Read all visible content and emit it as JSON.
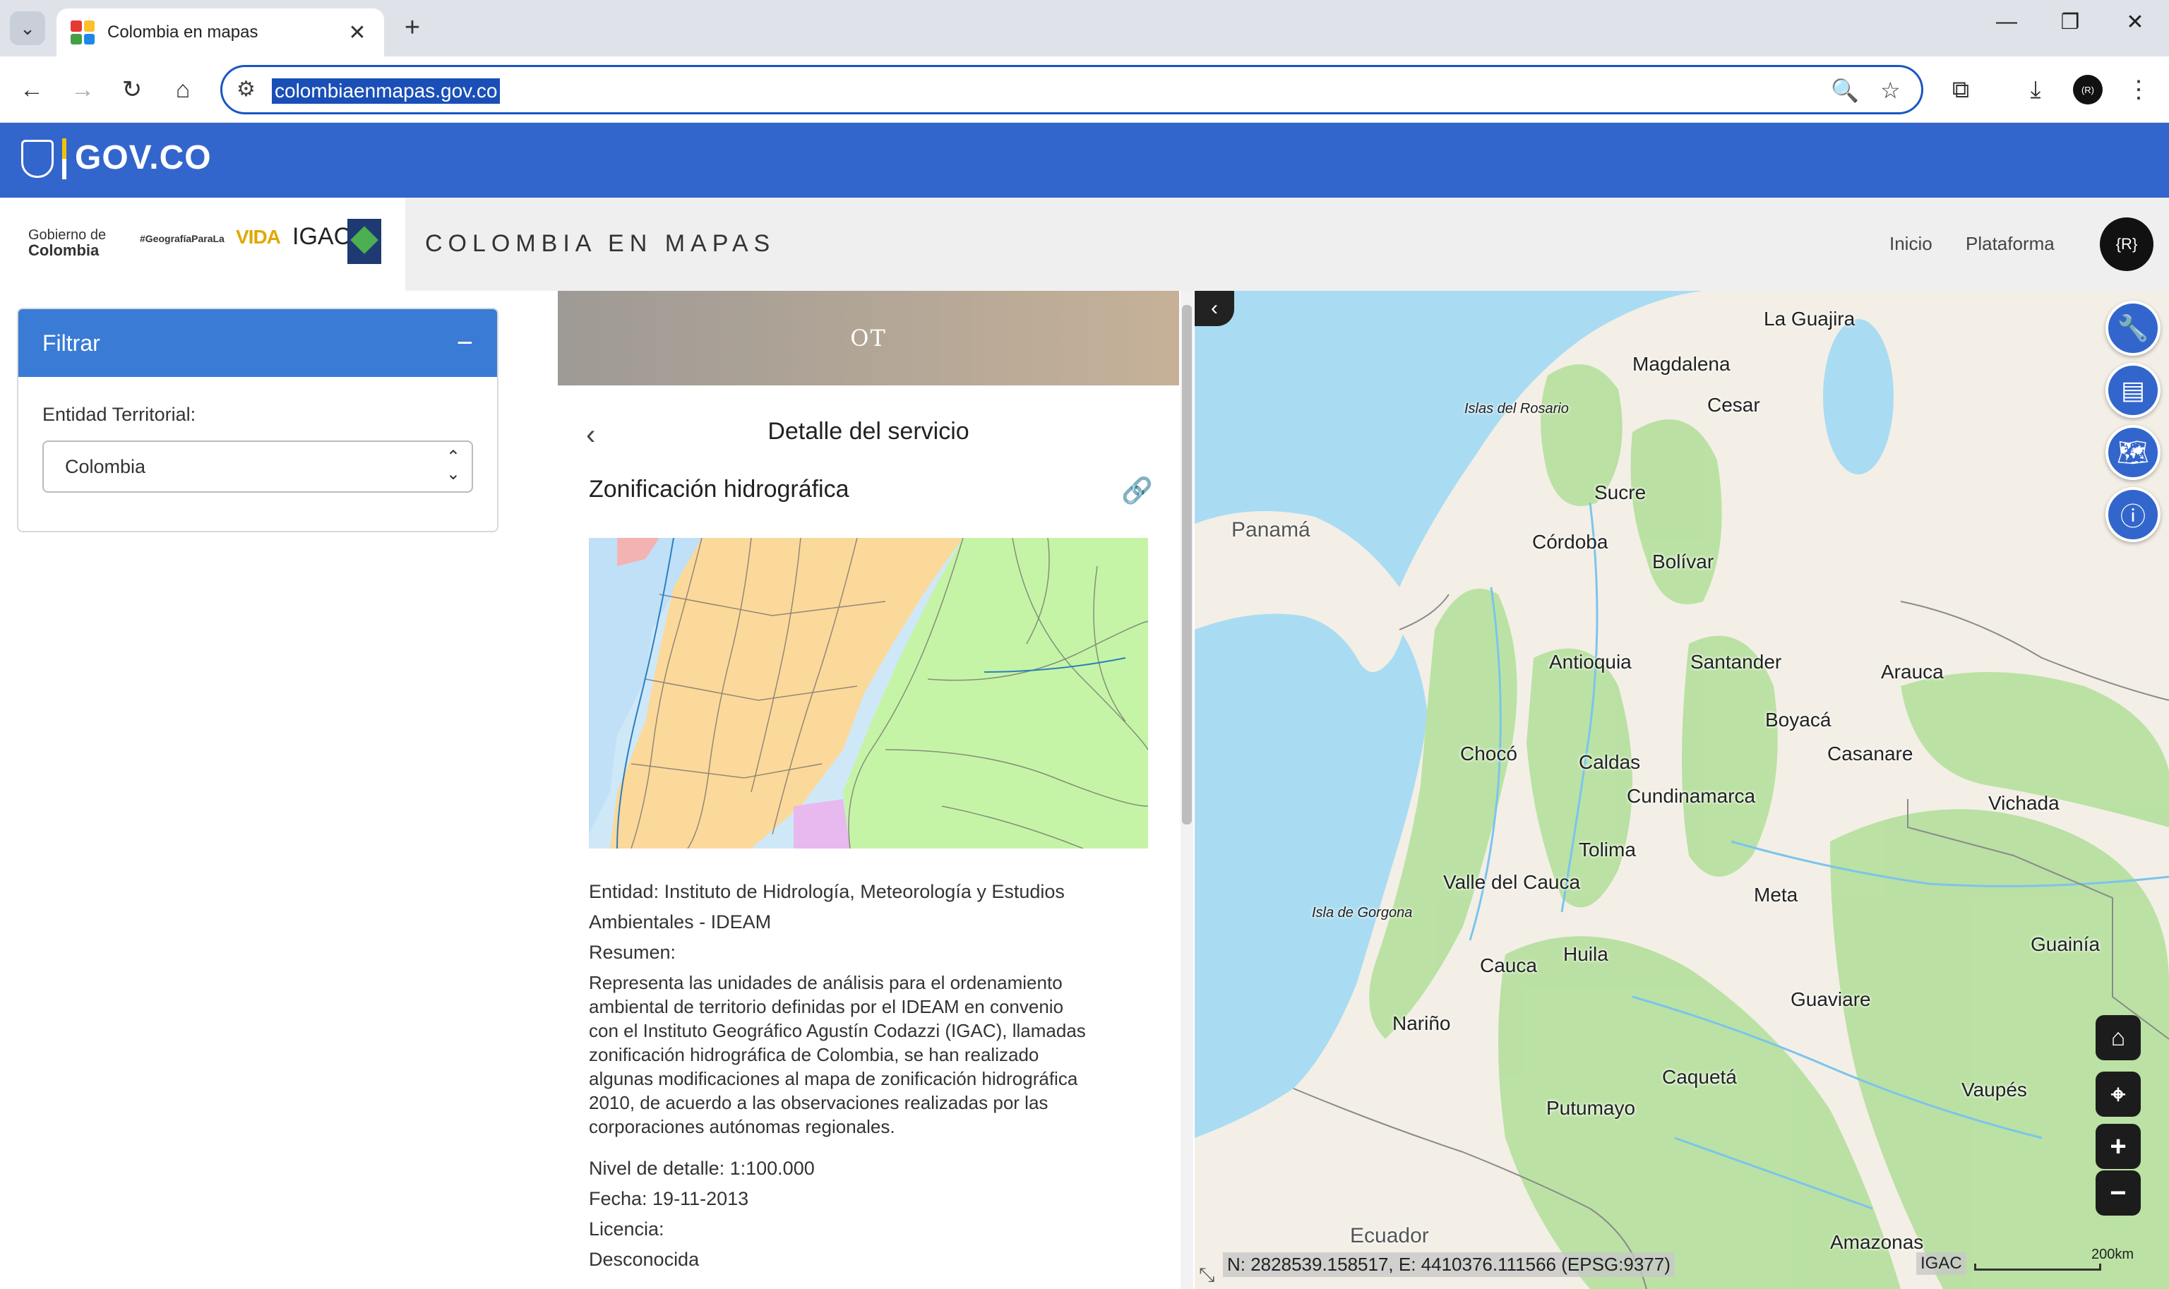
{
  "browser": {
    "tab_title": "Colombia en mapas",
    "url": "colombiaenmapas.gov.co",
    "new_tab_symbol": "+",
    "tab_close_symbol": "✕",
    "profile_initial": "(R)"
  },
  "gov_bar": {
    "brand": "GOV.CO"
  },
  "header": {
    "logo_gobierno_line1": "Gobierno de",
    "logo_gobierno_line2": "Colombia",
    "logo_hashtag": "#GeografíaParaLa",
    "logo_vida": "VIDA",
    "logo_igac": "IGAC",
    "site_title": "COLOMBIA EN MAPAS",
    "nav": [
      "Inicio",
      "Plataforma"
    ],
    "user_initial": "{R}"
  },
  "filter": {
    "title": "Filtrar",
    "collapse_symbol": "−",
    "entity_label": "Entidad Territorial:",
    "entity_value": "Colombia"
  },
  "detail": {
    "banner": "OT",
    "heading": "Detalle del servicio",
    "service_title": "Zonificación hidrográfica",
    "entity": "Entidad: Instituto de Hidrología, Meteorología y Estudios Ambientales - IDEAM",
    "entity_line1": "Entidad: Instituto de Hidrología, Meteorología y Estudios",
    "entity_line2": "Ambientales - IDEAM",
    "summary_label": "Resumen:",
    "summary_lines": [
      "Representa las unidades de análisis para el ordenamiento",
      "ambiental de territorio definidas por el IDEAM en convenio",
      "con el Instituto Geográfico Agustín Codazzi (IGAC), llamadas",
      "zonificación hidrográfica de Colombia, se han realizado",
      "algunas modificaciones al mapa de zonificación hidrográfica",
      "2010, de acuerdo a las observaciones realizadas por las",
      "corporaciones autónomas regionales."
    ],
    "detail_level": "Nivel de detalle: 1:100.000",
    "date": "Fecha: 19-11-2013",
    "license_label": "Licencia:",
    "license_value": "Desconocida"
  },
  "map": {
    "labels": {
      "la_guajira": "La Guajira",
      "islas_rosario": "Islas del Rosario",
      "magdalena": "Magdalena",
      "cesar": "Cesar",
      "sucre": "Sucre",
      "panama": "Panamá",
      "cordoba": "Córdoba",
      "bolivar": "Bolívar",
      "antioquia": "Antioquia",
      "santander": "Santander",
      "arauca": "Arauca",
      "boyaca": "Boyacá",
      "choco": "Chocó",
      "caldas": "Caldas",
      "casanare": "Casanare",
      "cundinamarca": "Cundinamarca",
      "vichada": "Vichada",
      "tolima": "Tolima",
      "valle": "Valle del Cauca",
      "meta": "Meta",
      "gorgona": "Isla de Gorgona",
      "guainia": "Guainía",
      "cauca": "Cauca",
      "huila": "Huila",
      "guaviare": "Guaviare",
      "narino": "Nariño",
      "caqueta": "Caquetá",
      "vaupes": "Vaupés",
      "putumayo": "Putumayo",
      "ecuador": "Ecuador",
      "amazonas": "Amazonas"
    },
    "coordinates": "N: 2828539.158517, E: 4410376.111566 (EPSG:9377)",
    "attribution": "IGAC",
    "scale": "200km",
    "zoom_in": "+",
    "zoom_out": "−"
  }
}
